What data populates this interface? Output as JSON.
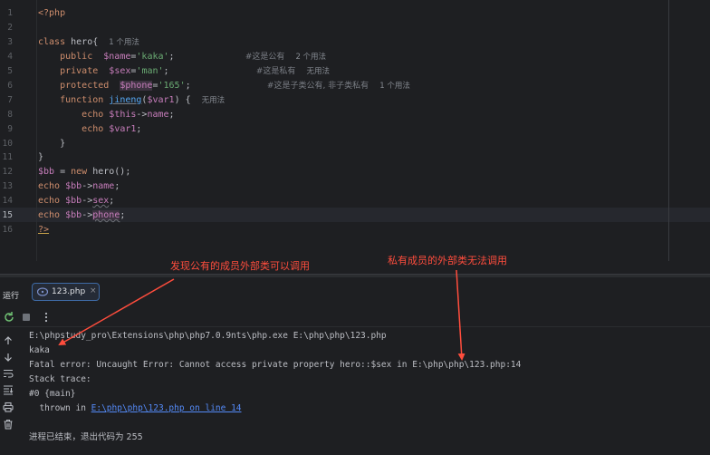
{
  "editor": {
    "line_numbers": [
      "1",
      "2",
      "3",
      "4",
      "5",
      "6",
      "7",
      "8",
      "9",
      "10",
      "11",
      "12",
      "13",
      "14",
      "15",
      "16"
    ],
    "lines": {
      "l1": {
        "open_tag": "<?php"
      },
      "l3": {
        "kw": "class",
        "name": " hero{",
        "hint": "1 个用法"
      },
      "l4": {
        "kw": "public",
        "var": "$name",
        "eq": "=",
        "str": "'kaka'",
        "semi": ";",
        "comment": "#这是公有",
        "hint": "2 个用法"
      },
      "l5": {
        "kw": "private",
        "var": "$sex",
        "eq": "=",
        "str": "'man'",
        "semi": ";",
        "comment": "#这是私有",
        "hint": "无用法"
      },
      "l6": {
        "kw": "protected",
        "var": "$phone",
        "eq": "=",
        "str": "'165'",
        "semi": ";",
        "comment": "#这是子类公有, 非子类私有",
        "hint": "1 个用法"
      },
      "l7": {
        "kw": "function",
        "fn": "jineng",
        "p1": "(",
        "var": "$var1",
        "p2": ") {",
        "hint": "无用法"
      },
      "l8": {
        "kw": "echo",
        "var": "$this",
        "arrow": "->",
        "prop": "name",
        "semi": ";"
      },
      "l9": {
        "kw": "echo",
        "var": "$var1",
        "semi": ";"
      },
      "l10": {
        "text": "}"
      },
      "l11": {
        "text": "}"
      },
      "l12": {
        "var": "$bb",
        "op": " = ",
        "kw": "new",
        "rest": " hero();"
      },
      "l13": {
        "kw": "echo",
        "var": "$bb",
        "arrow": "->",
        "prop": "name",
        "semi": ";"
      },
      "l14": {
        "kw": "echo",
        "var": "$bb",
        "arrow": "->",
        "prop": "sex",
        "semi": ";"
      },
      "l15": {
        "kw": "echo",
        "var": "$bb",
        "arrow": "->",
        "prop": "phone",
        "semi": ";"
      },
      "l16": {
        "close_tag": "?>"
      }
    }
  },
  "run_panel": {
    "label": "运行",
    "tab_label": "123.php",
    "tab_close": "×",
    "output": {
      "cmd": "E:\\phpstudy_pro\\Extensions\\php\\php7.0.9nts\\php.exe E:\\php\\php\\123.php",
      "out1": "kaka",
      "err": "Fatal error: Uncaught Error: Cannot access private property hero::$sex in E:\\php\\php\\123.php:14",
      "trace": "Stack trace:",
      "main": "#0 {main}",
      "thrown": "  thrown in ",
      "thrown_link": "E:\\php\\php\\123.php on line 14",
      "exit": "进程已结束，退出代码为 255"
    }
  },
  "annotations": {
    "public_note": "发现公有的成员外部类可以调用",
    "private_note": "私有成员的外部类无法调用"
  },
  "colors": {
    "annotation": "#ff4d3d",
    "keyword": "#cf8e6d",
    "variable": "#c77dbb",
    "string": "#6aab73",
    "link": "#548af7"
  }
}
